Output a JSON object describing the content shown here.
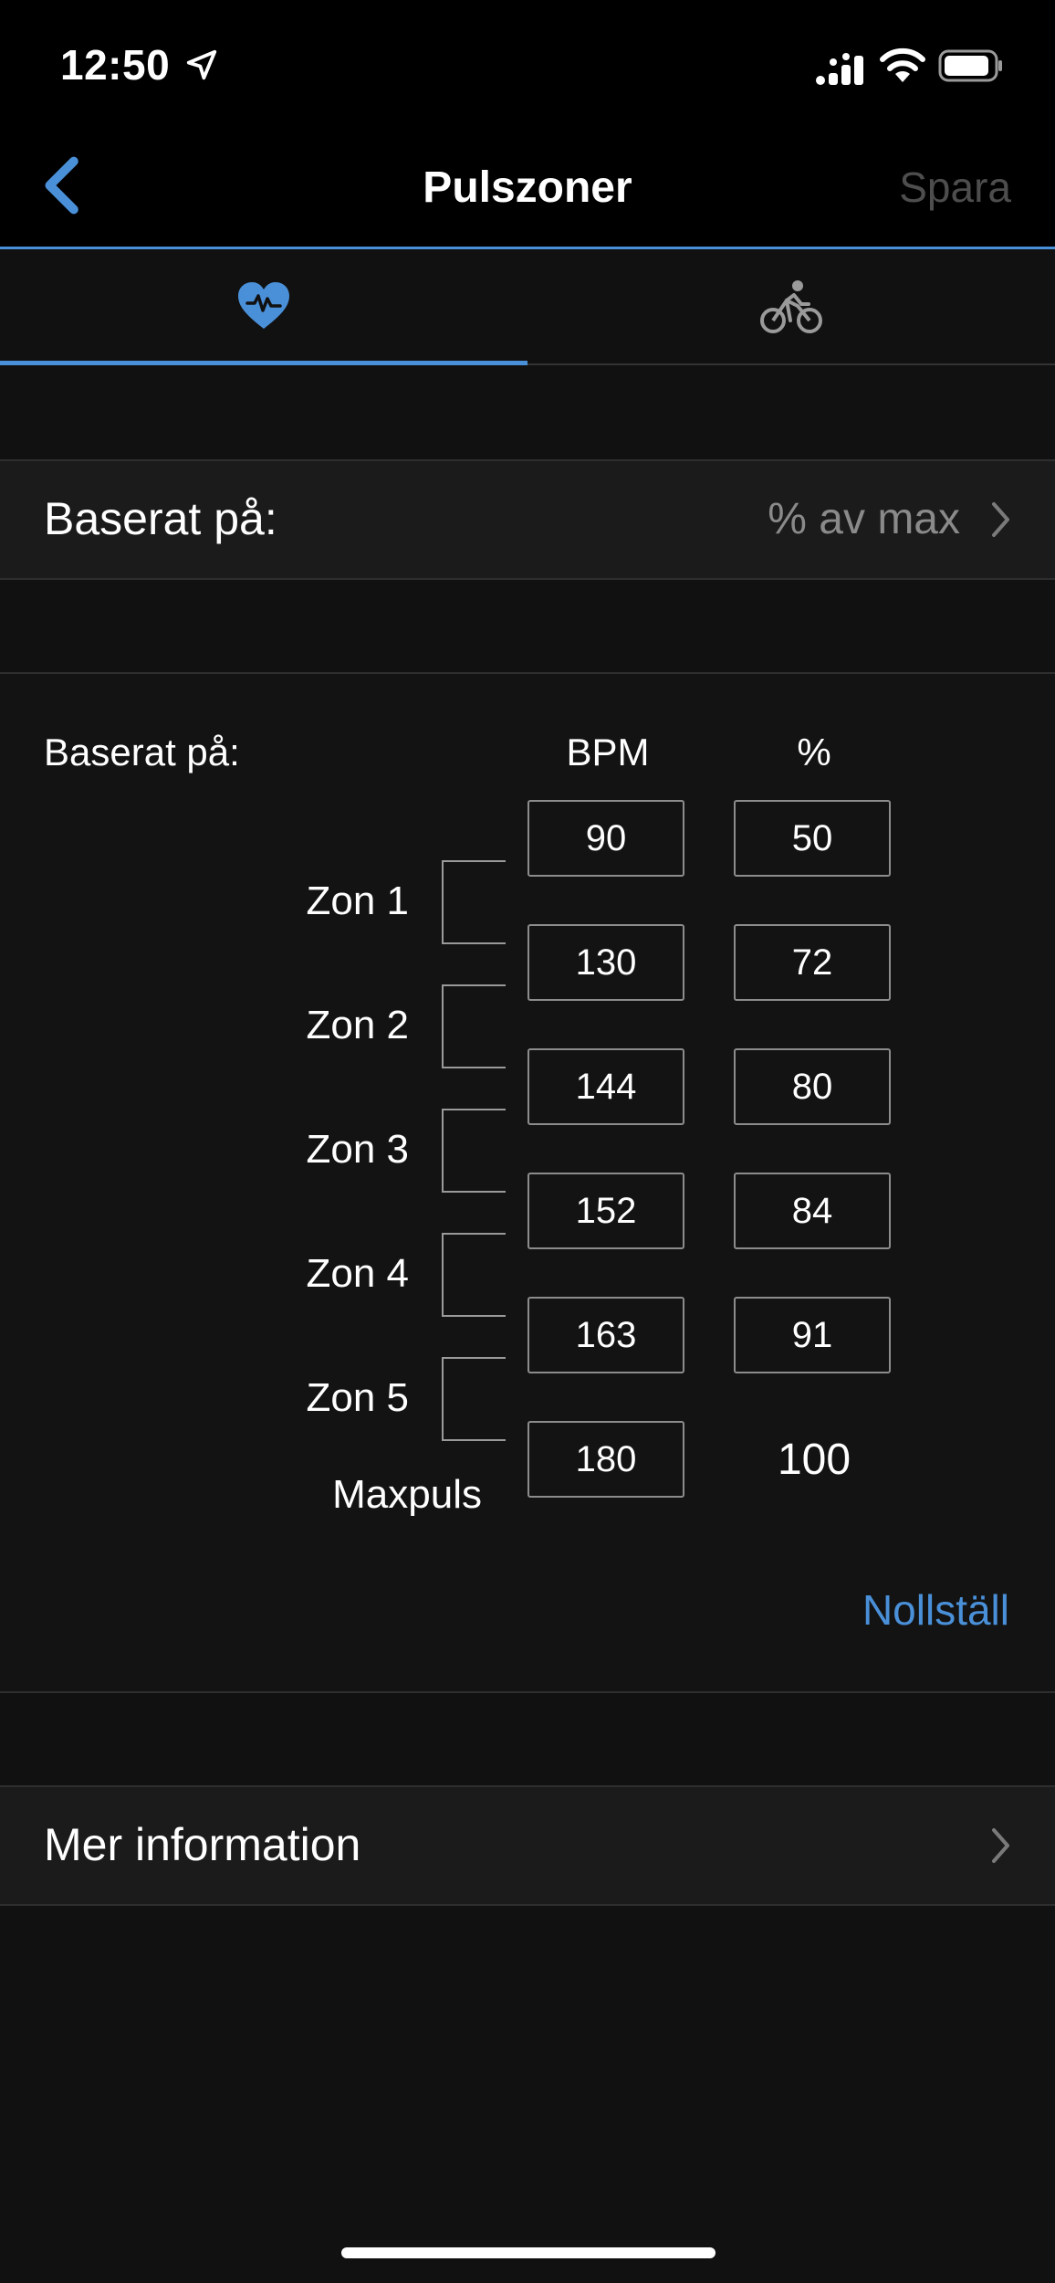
{
  "status_bar": {
    "time": "12:50"
  },
  "nav": {
    "title": "Pulszoner",
    "save_label": "Spara"
  },
  "tabs": [
    {
      "name": "heart-rate",
      "icon": "heart-icon",
      "active": true
    },
    {
      "name": "cycling",
      "icon": "bike-icon",
      "active": false
    }
  ],
  "based_on_row": {
    "label": "Baserat på:",
    "value": "% av max"
  },
  "zones": {
    "based_on_label": "Baserat på:",
    "bpm_header": "BPM",
    "pct_header": "%",
    "zone_labels": [
      "Zon 1",
      "Zon 2",
      "Zon 3",
      "Zon 4",
      "Zon 5"
    ],
    "max_label": "Maxpuls",
    "bpm_values": [
      "90",
      "130",
      "144",
      "152",
      "163",
      "180"
    ],
    "pct_values": [
      "50",
      "72",
      "80",
      "84",
      "91"
    ],
    "max_pct": "100",
    "reset_label": "Nollställ"
  },
  "more_info_row": {
    "label": "Mer information"
  },
  "colors": {
    "accent": "#4a90d9",
    "background": "#111111",
    "row_background": "#1b1b1b",
    "disabled_text": "#4d4d4d"
  }
}
